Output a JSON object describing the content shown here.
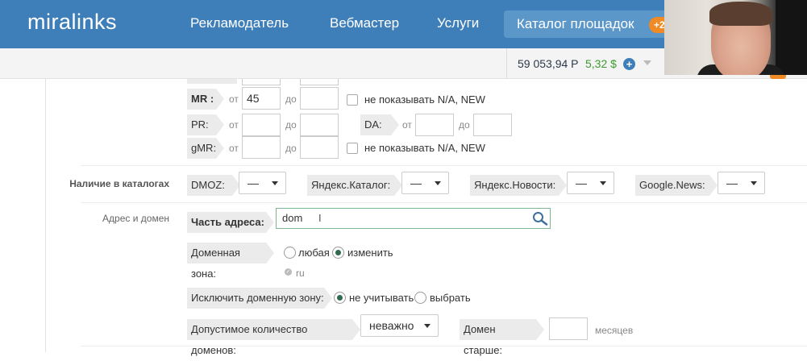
{
  "header": {
    "logo": "miralinks",
    "nav": [
      "Рекламодатель",
      "Вебмастер",
      "Услуги"
    ],
    "active_nav": "Каталог площадок",
    "badge": "+2"
  },
  "balance": {
    "rub": "59 053,94 Р",
    "usd": "5,32 $"
  },
  "filters": {
    "mr": {
      "label": "MR :",
      "from_label": "от",
      "from_value": "45",
      "to_label": "до",
      "to_value": "",
      "na_label": "не показывать N/A, NEW"
    },
    "pr": {
      "label": "PR:",
      "from_label": "от",
      "to_label": "до"
    },
    "da": {
      "label": "DA:",
      "from_label": "от",
      "to_label": "до"
    },
    "gmr": {
      "label": "gMR:",
      "from_label": "от",
      "to_label": "до",
      "na_label": "не показывать N/A, NEW"
    }
  },
  "catalogs": {
    "section_label": "Наличие в каталогах",
    "dmoz": {
      "label": "DMOZ:",
      "value": "—"
    },
    "yandex_catalog": {
      "label": "Яндекс.Каталог:",
      "value": "—"
    },
    "yandex_news": {
      "label": "Яндекс.Новости:",
      "value": "—"
    },
    "google_news": {
      "label": "Google.News:",
      "value": "—"
    }
  },
  "address": {
    "section_label": "Адрес и домен",
    "part_label": "Часть адреса:",
    "part_value": "dom",
    "zone_label": "Доменная зона:",
    "zone_any": "любая",
    "zone_change": "изменить",
    "zone_selected": "ru",
    "exclude_label": "Исключить доменную зону:",
    "exclude_ignore": "не учитывать",
    "exclude_choose": "выбрать",
    "count_label": "Допустимое количество доменов:",
    "count_value": "неважно",
    "older_label": "Домен старше:",
    "older_value": "",
    "older_unit": "месяцев"
  }
}
